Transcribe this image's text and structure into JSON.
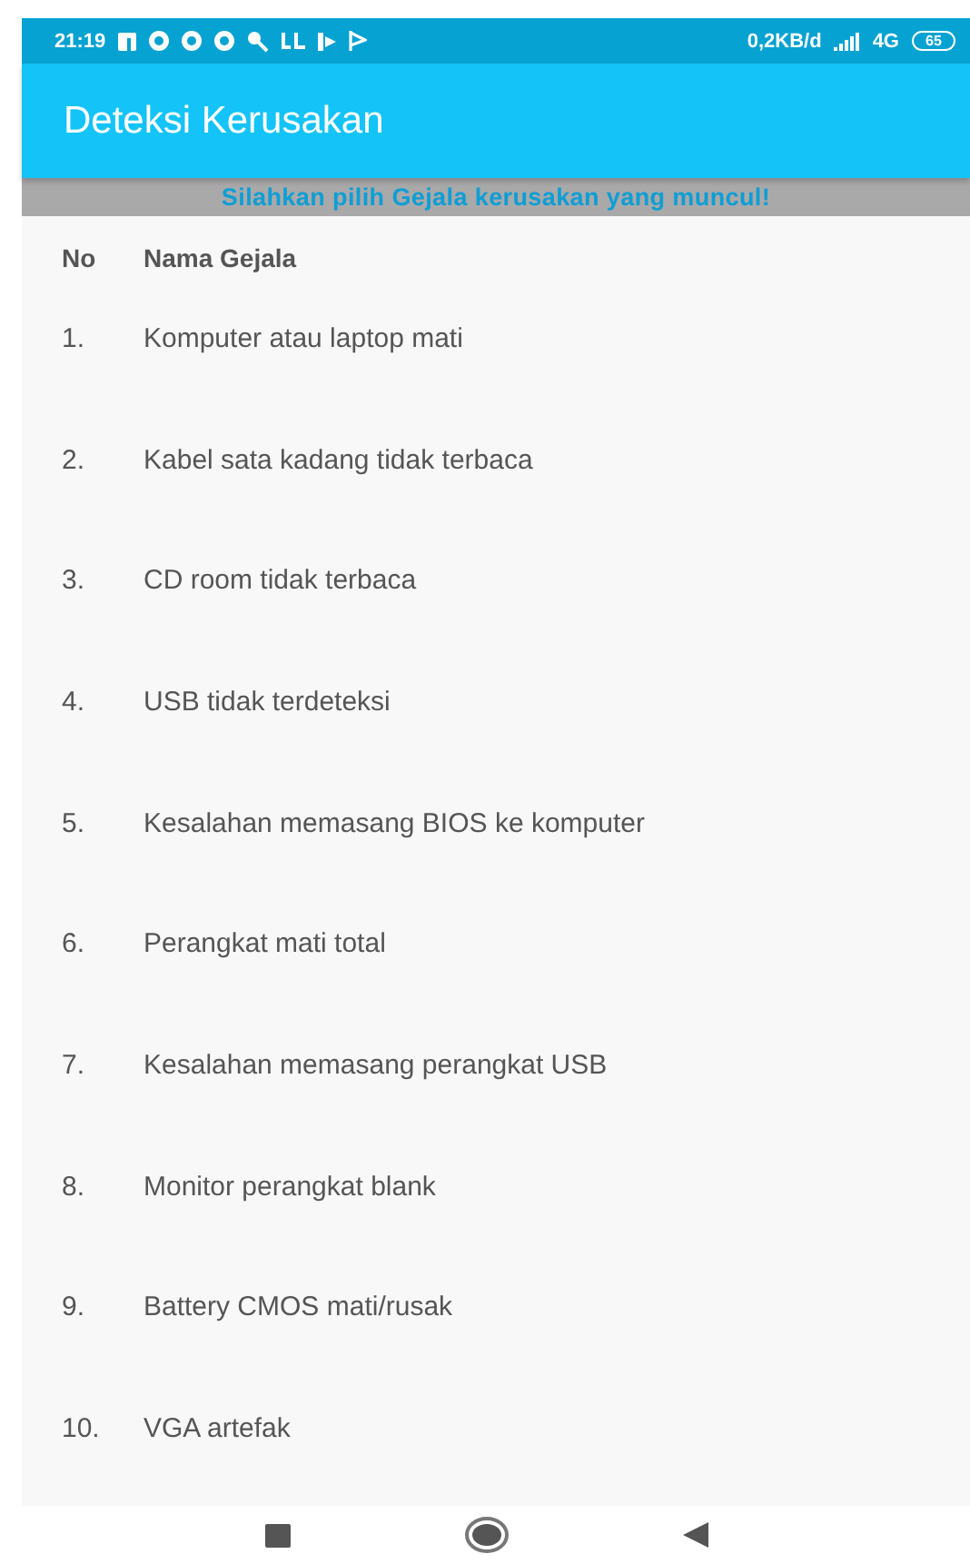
{
  "status_bar": {
    "time": "21:19",
    "speed": "0,2KB/d",
    "network": "4G",
    "battery": "65"
  },
  "app_bar": {
    "title": "Deteksi Kerusakan"
  },
  "banner": "Silahkan pilih Gejala kerusakan yang muncul!",
  "table": {
    "columns": [
      "No",
      "Nama Gejala"
    ],
    "rows": [
      {
        "no": "1.",
        "name": "Komputer atau laptop mati"
      },
      {
        "no": "2.",
        "name": "Kabel sata kadang tidak terbaca"
      },
      {
        "no": "3.",
        "name": "CD room tidak terbaca"
      },
      {
        "no": "4.",
        "name": "USB tidak terdeteksi"
      },
      {
        "no": "5.",
        "name": "Kesalahan memasang BIOS ke komputer"
      },
      {
        "no": "6.",
        "name": "Perangkat mati total"
      },
      {
        "no": "7.",
        "name": "Kesalahan memasang perangkat USB"
      },
      {
        "no": "8.",
        "name": "Monitor perangkat blank"
      },
      {
        "no": "9.",
        "name": "Battery CMOS mati/rusak"
      },
      {
        "no": "10.",
        "name": "VGA artefak"
      }
    ]
  }
}
